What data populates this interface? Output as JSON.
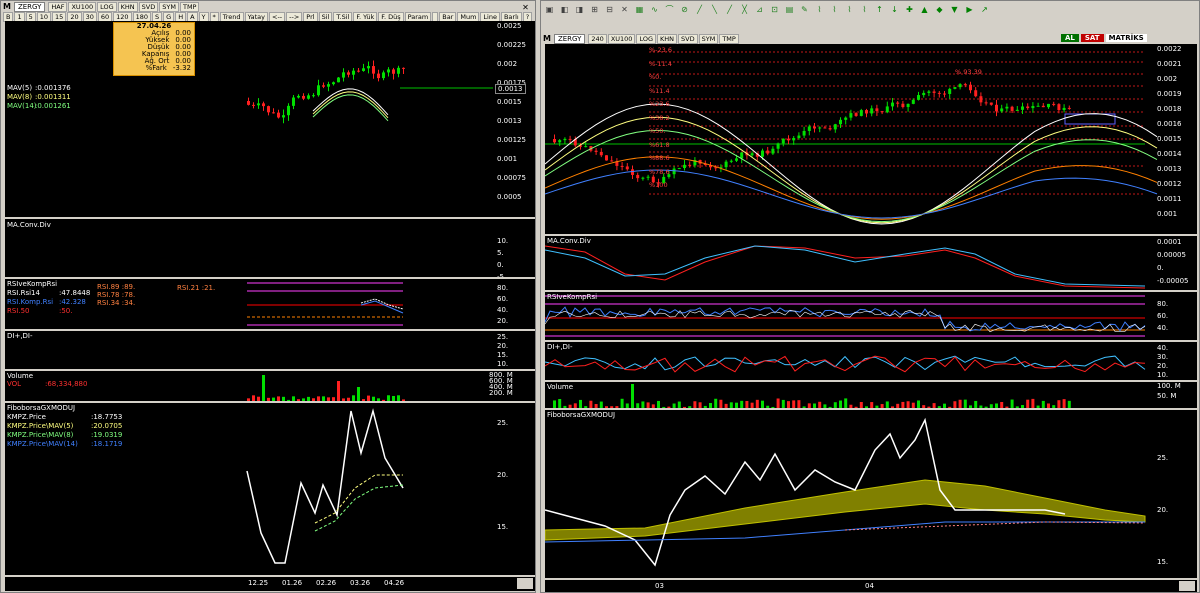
{
  "left": {
    "symbol": "ZERGY",
    "toolbar1": [
      "HAF",
      "XU100",
      "LOG",
      "KHN",
      "SVD",
      "SYM",
      "TMP"
    ],
    "toolbar2": [
      "B",
      "1",
      "5",
      "10",
      "15",
      "20",
      "30",
      "60",
      "120",
      "180",
      "S",
      "G",
      "H",
      "A",
      "Y",
      "*",
      "Trend",
      "Yatay",
      "<--",
      "-->",
      "Prl",
      "Sil",
      "T.Sil",
      "F. Yük",
      "F. Düş",
      "Param",
      "",
      "Bar",
      "Mum",
      "Line",
      "Barlı",
      "?"
    ],
    "infobox": {
      "date": "27.04.26",
      "rows": [
        {
          "label": "Açılış",
          "value": "0.00"
        },
        {
          "label": "Yüksek",
          "value": "0.00"
        },
        {
          "label": "Düşük",
          "value": "0.00"
        },
        {
          "label": "Kapanış",
          "value": "0.00"
        },
        {
          "label": "Ağ. Ort",
          "value": "0.00"
        },
        {
          "label": "%Fark",
          "value": "-3.32"
        }
      ]
    },
    "mav": [
      {
        "label": "MAV(5)",
        "value": ":0.001376"
      },
      {
        "label": "MAV(8)",
        "value": ":0.001311"
      },
      {
        "label": "MAV(14)",
        "value": ":0.001261"
      }
    ],
    "price_axis": [
      "0.0025",
      "0.00225",
      "0.002",
      "0.00175",
      "0.0015",
      "0.0013",
      "0.00125",
      "0.001",
      "0.00075",
      "0.0005"
    ],
    "last_price": "0.0013",
    "macd_title": "MA.Conv.Div",
    "macd_axis": [
      "10.",
      "5.",
      "0.",
      "-5."
    ],
    "rsi": {
      "title": "RSIveKompRsi",
      "rows": [
        {
          "label": "RSI.Rsi14",
          "value": ":47.8448"
        },
        {
          "label": "RSI.Komp.Rsi",
          "value": ":42.328"
        },
        {
          "label": "RSI.50",
          "value": ":50."
        }
      ],
      "mid": [
        "RSI.89  :89.",
        "RSI.78  :78.",
        "RSI.34  :34."
      ],
      "right": "RSI.21  :21.",
      "axis": [
        "80.",
        "60.",
        "40.",
        "20."
      ]
    },
    "di_title": "DI+,DI-",
    "di_axis": [
      "25.",
      "20.",
      "15.",
      "10."
    ],
    "volume": {
      "title": "Volume",
      "row_label": "VOL",
      "row_value": ":68,334,880",
      "axis": [
        "800. M",
        "600. M",
        "400. M",
        "200. M"
      ]
    },
    "fibo": {
      "title": "FiboborsaGXMODUJ",
      "rows": [
        {
          "label": "KMPZ.Price",
          "value": ":18.7753"
        },
        {
          "label": "KMPZ.Price\\MAV(5)",
          "value": ":20.0705"
        },
        {
          "label": "KMPZ.Price\\MAV(8)",
          "value": ":19.0319"
        },
        {
          "label": "KMPZ.Price\\MAV(14)",
          "value": ":18.1719"
        }
      ],
      "axis": [
        "25.",
        "20.",
        "15."
      ]
    },
    "dates": [
      "12.25",
      "01.26",
      "02.26",
      "03.26",
      "04.26"
    ]
  },
  "right": {
    "symbol": "ZERGY",
    "toolbar": [
      "240",
      "XU100",
      "LOG",
      "KHN",
      "SVD",
      "SYM",
      "TMP"
    ],
    "buttons": {
      "al": "AL",
      "sat": "SAT",
      "brand": "MATRİKS"
    },
    "fib_labels": [
      "%-23.6",
      "%-11.4",
      "%0.",
      "%11.4",
      "%23.6",
      "%38.2",
      "%50.",
      "%61.8",
      "%88.6",
      "%78.6",
      "%100"
    ],
    "fib_tag": "% 93.39",
    "price_axis": [
      "0.0022",
      "0.0021",
      "0.002",
      "0.0019",
      "0.0018",
      "0.0016",
      "0.0015",
      "0.0014",
      "0.0013",
      "0.0012",
      "0.0011",
      "0.001"
    ],
    "last_price": "0.0013",
    "macd_title": "MA.Conv.Div",
    "macd_axis": [
      "0.0001",
      "0.00005",
      "0.",
      "-0.00005"
    ],
    "rsi_title": "RSIveKompRsi",
    "rsi_axis": [
      "80.",
      "60.",
      "40."
    ],
    "di_title": "DI+,DI-",
    "di_axis": [
      "40.",
      "30.",
      "20.",
      "10."
    ],
    "volume_title": "Volume",
    "volume_axis": [
      "100. M",
      "50. M"
    ],
    "fibo_title": "FiboborsaGXMODUJ",
    "fibo_axis": [
      "25.",
      "20.",
      "15."
    ],
    "dates": [
      "03",
      "04"
    ]
  },
  "colors": {
    "up": "#00e000",
    "down": "#ff2020",
    "mav5": "#ffffff",
    "mav8": "#ffff80",
    "mav14": "#80ff80",
    "rsi": "#4080ff",
    "fib": "#ff4040"
  }
}
